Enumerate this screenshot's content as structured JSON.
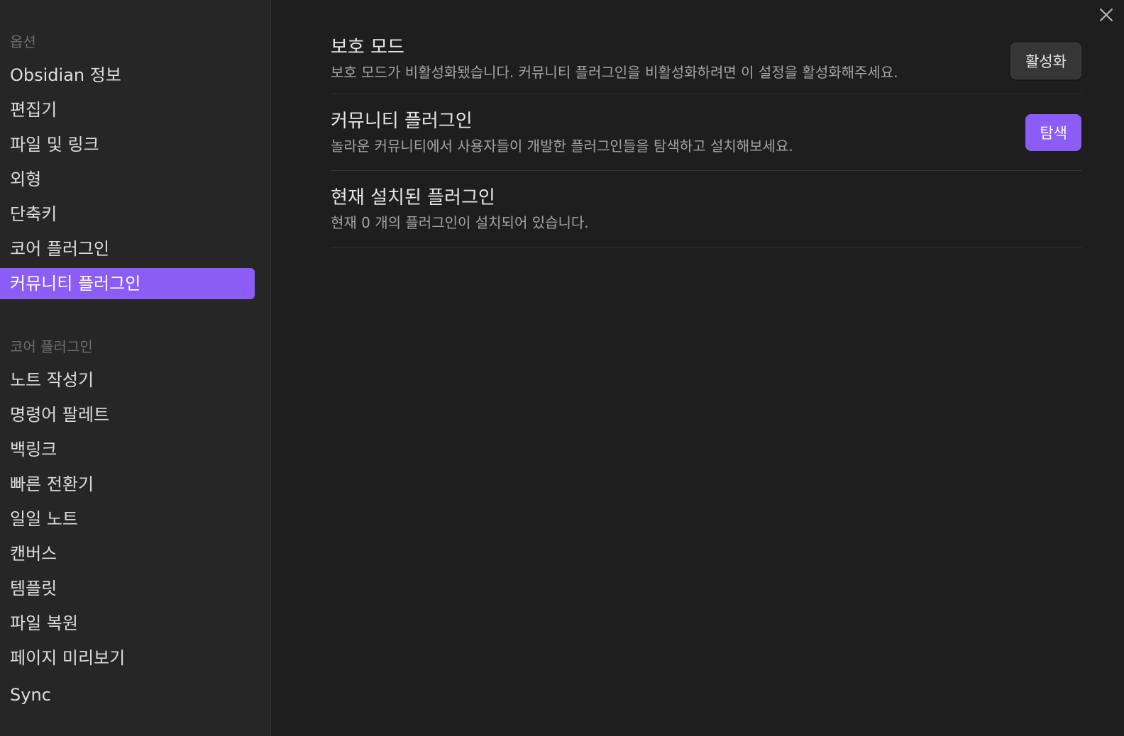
{
  "sidebar": {
    "options_title": "옵션",
    "options": [
      {
        "label": "Obsidian 정보"
      },
      {
        "label": "편집기"
      },
      {
        "label": "파일 및 링크"
      },
      {
        "label": "외형"
      },
      {
        "label": "단축키"
      },
      {
        "label": "코어 플러그인"
      },
      {
        "label": "커뮤니티 플러그인",
        "active": true
      }
    ],
    "core_title": "코어 플러그인",
    "core_plugins": [
      {
        "label": "노트 작성기"
      },
      {
        "label": "명령어 팔레트"
      },
      {
        "label": "백링크"
      },
      {
        "label": "빠른 전환기"
      },
      {
        "label": "일일 노트"
      },
      {
        "label": "캔버스"
      },
      {
        "label": "템플릿"
      },
      {
        "label": "파일 복원"
      },
      {
        "label": "페이지 미리보기"
      },
      {
        "label": "Sync"
      }
    ]
  },
  "main": {
    "settings": [
      {
        "name": "보호 모드",
        "desc": "보호 모드가 비활성화됐습니다. 커뮤니티 플러그인을 비활성화하려면 이 설정을 활성화해주세요.",
        "button": "활성화"
      },
      {
        "name": "커뮤니티 플러그인",
        "desc": "놀라운 커뮤니티에서 사용자들이 개발한 플러그인들을 탐색하고 설치해보세요.",
        "button": "탐색"
      },
      {
        "name": "현재 설치된 플러그인",
        "desc": "현재 0 개의 플러그인이 설치되어 있습니다."
      }
    ]
  },
  "icons": {
    "close": "close-icon"
  },
  "colors": {
    "accent": "#8b5cf6",
    "background": "#1e1e1e",
    "sidebar": "#262626"
  }
}
